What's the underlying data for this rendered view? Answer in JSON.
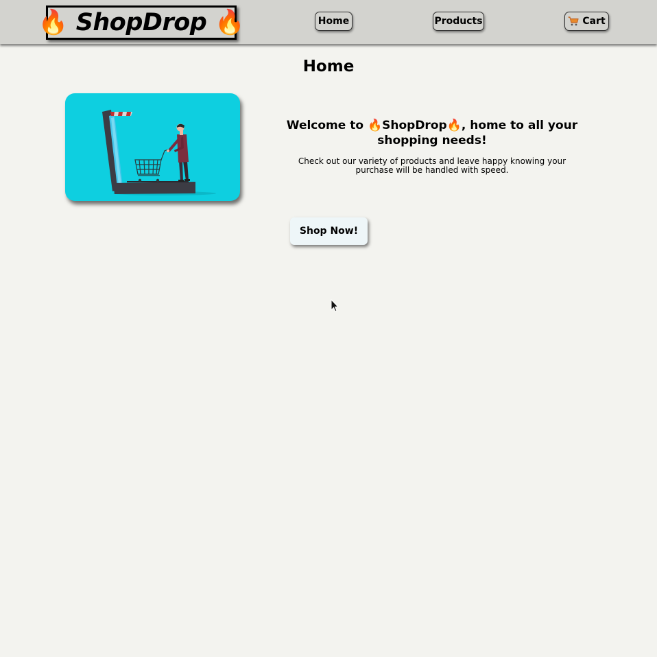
{
  "header": {
    "logo": {
      "icon_left": "fire-icon",
      "text": "ShopDrop",
      "icon_right": "fire-icon"
    },
    "nav": {
      "home_label": "Home",
      "products_label": "Products",
      "cart_label": "Cart",
      "cart_icon": "shopping-cart-icon"
    }
  },
  "main": {
    "title": "Home",
    "hero_image_icon": "person-with-shopping-cart-illustration",
    "welcome_prefix": "Welcome to ",
    "welcome_brand": "ShopDrop",
    "welcome_suffix": ", home to all your shopping needs!",
    "subtext": "Check out our variety of products and leave happy knowing your purchase will be handled with speed.",
    "cta_label": "Shop Now!"
  },
  "colors": {
    "page_background": "#f3f3ef",
    "navbar_background": "#d3d3cf",
    "hero_background": "#0ecfe0",
    "cta_background": "#eef6f8"
  }
}
